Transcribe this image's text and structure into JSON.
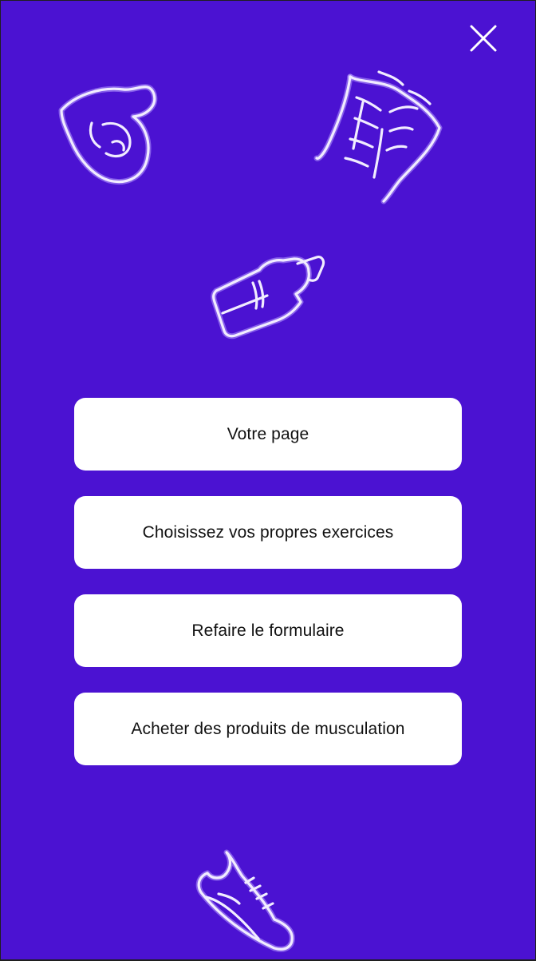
{
  "close": {
    "icon": "close-icon",
    "color": "#ffffff"
  },
  "decorations": [
    {
      "icon": "flexed-arm-icon"
    },
    {
      "icon": "abs-torso-icon"
    },
    {
      "icon": "water-bottle-icon"
    },
    {
      "icon": "sneaker-icon"
    }
  ],
  "menu": {
    "items": [
      {
        "label": "Votre page"
      },
      {
        "label": "Choisissez vos propres exercices"
      },
      {
        "label": "Refaire le formulaire"
      },
      {
        "label": "Acheter des produits de musculation"
      }
    ]
  },
  "colors": {
    "background": "#4b12d2",
    "button_background": "#ffffff",
    "button_text": "#111111",
    "doodle_stroke": "#f1ecff"
  }
}
